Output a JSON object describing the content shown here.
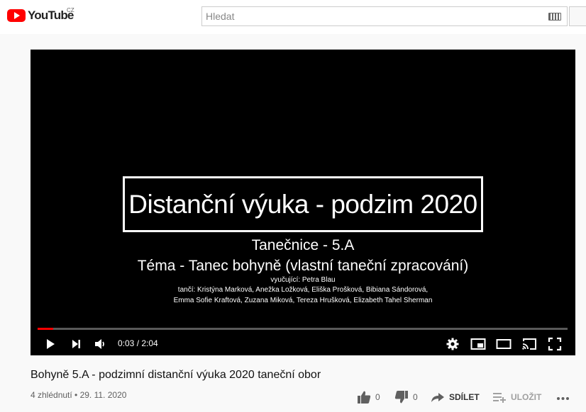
{
  "masthead": {
    "logo_text": "YouTube",
    "country_code": "CZ",
    "search_placeholder": "Hledat"
  },
  "player": {
    "slide": {
      "title": "Distanční výuka - podzim 2020",
      "line1": "Tanečnice - 5.A",
      "line2": "Téma - Tanec bohyně (vlastní taneční zpracování)",
      "line3": "vyučující: Petra Blau",
      "line4": "tančí: Kristýna Marková, Anežka Ložková, Eliška Prošková, Bibiana Sándorová,",
      "line5": "Emma Sofie Kraftová, Zuzana Miková,  Tereza Hrušková, Elizabeth Tahel Sherman"
    },
    "progress_fraction": 0.03,
    "time": "0:03 / 2:04"
  },
  "video": {
    "title": "Bohyně 5.A - podzimní distanční výuka 2020 taneční obor",
    "views_date": "4 zhlédnutí • 29. 11. 2020",
    "likes": "0",
    "dislikes": "0",
    "share_label": "SDÍLET",
    "save_label": "ULOŽIT"
  },
  "colors": {
    "brand_red": "#ff0000",
    "icon_gray": "#606060"
  }
}
